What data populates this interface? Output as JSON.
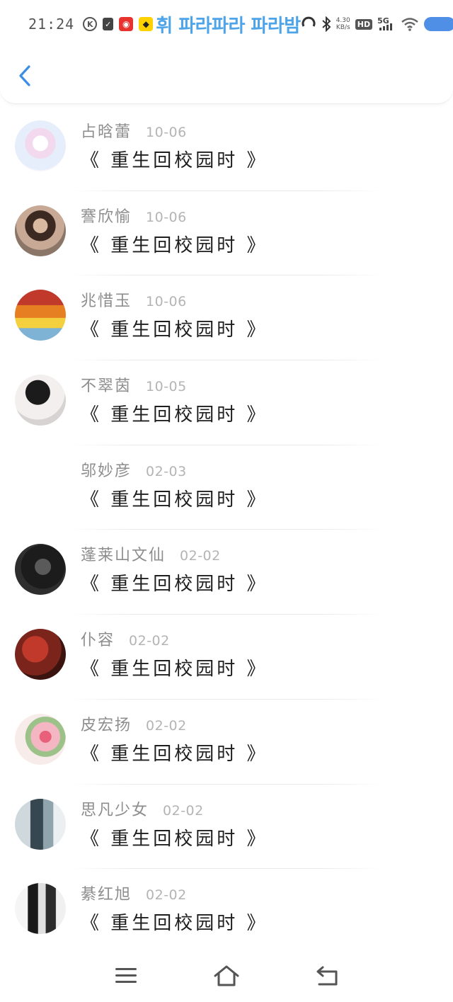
{
  "status_bar": {
    "time": "21:24",
    "banner": "휘 파라파라 파라밤",
    "speed_value": "4.30",
    "speed_unit": "KB/s",
    "hd": "HD",
    "network": "5G",
    "icons": [
      "k-icon",
      "clipboard-icon",
      "netease-music-icon",
      "app-icon",
      "sync-icon",
      "bluetooth-icon",
      "wifi-icon",
      "battery-icon"
    ]
  },
  "header": {
    "back_icon": "chevron-left-icon",
    "accent": "#3a8ee6"
  },
  "comments": [
    {
      "name": "占晗蕾",
      "date": "10-06",
      "text": "《 重生回校园时 》",
      "avatar": "pink-hair-girl"
    },
    {
      "name": "謇欣愉",
      "date": "10-06",
      "text": "《 重生回校园时 》",
      "avatar": "girl-photo"
    },
    {
      "name": "兆惜玉",
      "date": "10-06",
      "text": "《 重生回校园时 》",
      "avatar": "colorful-scene"
    },
    {
      "name": "不翠茵",
      "date": "10-05",
      "text": "《 重生回校园时 》",
      "avatar": "anime-boy"
    },
    {
      "name": "邬妙彦",
      "date": "02-03",
      "text": "《 重生回校园时 》",
      "avatar": ""
    },
    {
      "name": "蓬莱山文仙",
      "date": "02-02",
      "text": "《 重生回校园时 》",
      "avatar": "dark-figure"
    },
    {
      "name": "仆容",
      "date": "02-02",
      "text": "《 重生回校园时 》",
      "avatar": "red-umbrella"
    },
    {
      "name": "皮宏扬",
      "date": "02-02",
      "text": "《 重生回校园时 》",
      "avatar": "pink-flowers"
    },
    {
      "name": "思凡少女",
      "date": "02-02",
      "text": "《 重生回校园时 》",
      "avatar": "couple-photo"
    },
    {
      "name": "綦红旭",
      "date": "02-02",
      "text": "《 重生回校园时 》",
      "avatar": "bw-couple"
    }
  ],
  "bottom_nav": [
    "menu-icon",
    "home-icon",
    "back-icon"
  ]
}
